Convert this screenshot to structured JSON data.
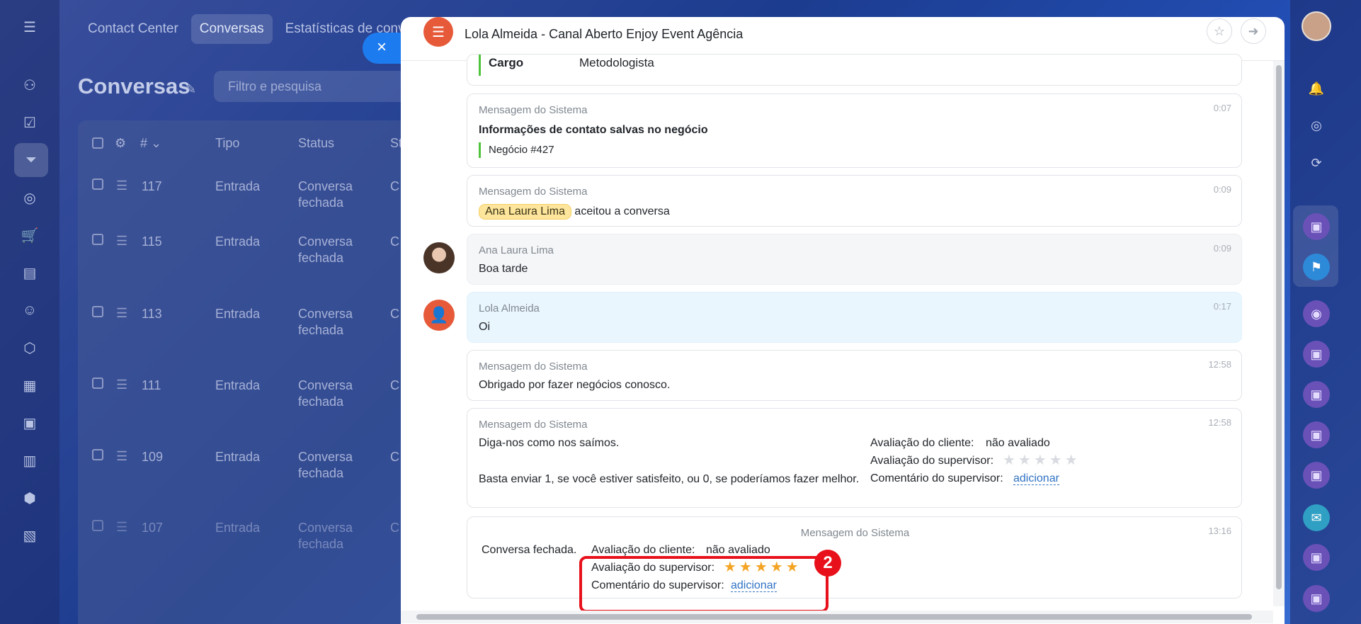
{
  "nav": {
    "tabs": [
      "Contact Center",
      "Conversas",
      "Estatísticas de conver"
    ]
  },
  "page": {
    "title": "Conversas",
    "filter_placeholder": "Filtro e pesquisa"
  },
  "grid": {
    "headers": [
      "#",
      "Tipo",
      "Status",
      "St"
    ],
    "rows": [
      {
        "id": "117",
        "tipo": "Entrada",
        "status": "Conversa fechada",
        "st": "C"
      },
      {
        "id": "115",
        "tipo": "Entrada",
        "status": "Conversa fechada",
        "st": "C"
      },
      {
        "id": "113",
        "tipo": "Entrada",
        "status": "Conversa fechada",
        "st": "C"
      },
      {
        "id": "111",
        "tipo": "Entrada",
        "status": "Conversa fechada",
        "st": "C"
      },
      {
        "id": "109",
        "tipo": "Entrada",
        "status": "Conversa fechada",
        "st": "C"
      },
      {
        "id": "107",
        "tipo": "Entrada",
        "status": "Conversa fechada",
        "st": "C"
      }
    ]
  },
  "panel": {
    "title": "Lola Almeida - Canal Aberto Enjoy Event Agência",
    "close_glyph": "×"
  },
  "messages": {
    "m0": {
      "label": "Cargo",
      "value": "Metodologista"
    },
    "m1": {
      "from": "Mensagem do Sistema",
      "time": "0:07",
      "text": "Informações de contato salvas no negócio",
      "link": "Negócio #427"
    },
    "m2": {
      "from": "Mensagem do Sistema",
      "time": "0:09",
      "tag": "Ana Laura Lima",
      "text": "aceitou a conversa"
    },
    "m3": {
      "from": "Ana Laura Lima",
      "time": "0:09",
      "text": "Boa tarde"
    },
    "m4": {
      "from": "Lola Almeida",
      "time": "0:17",
      "text": "Oi"
    },
    "m5": {
      "from": "Mensagem do Sistema",
      "time": "12:58",
      "text": "Obrigado por fazer negócios conosco."
    },
    "m6": {
      "from": "Mensagem do Sistema",
      "time": "12:58",
      "text1": "Diga-nos como nos saímos.",
      "text2": "Basta enviar 1, se você estiver satisfeito, ou 0, se poderíamos fazer melhor.",
      "client_label": "Avaliação do cliente:",
      "client_value": "não avaliado",
      "supervisor_label": "Avaliação do supervisor:",
      "supervisor_rating": 0,
      "comment_label": "Comentário do supervisor:",
      "comment_link": "adicionar"
    },
    "m7": {
      "from": "Mensagem do Sistema",
      "time": "13:16",
      "closed": "Conversa fechada.",
      "client_label": "Avaliação do cliente:",
      "client_value": "não avaliado",
      "supervisor_label": "Avaliação do supervisor:",
      "supervisor_rating": 5,
      "comment_label": "Comentário do supervisor:",
      "comment_link": "adicionar"
    }
  },
  "annotation": {
    "badge": "2",
    "color": "#e8101a"
  },
  "colors": {
    "accent": "#1d7bf0",
    "brand": "#e65a3a",
    "star": "#f4a424"
  }
}
